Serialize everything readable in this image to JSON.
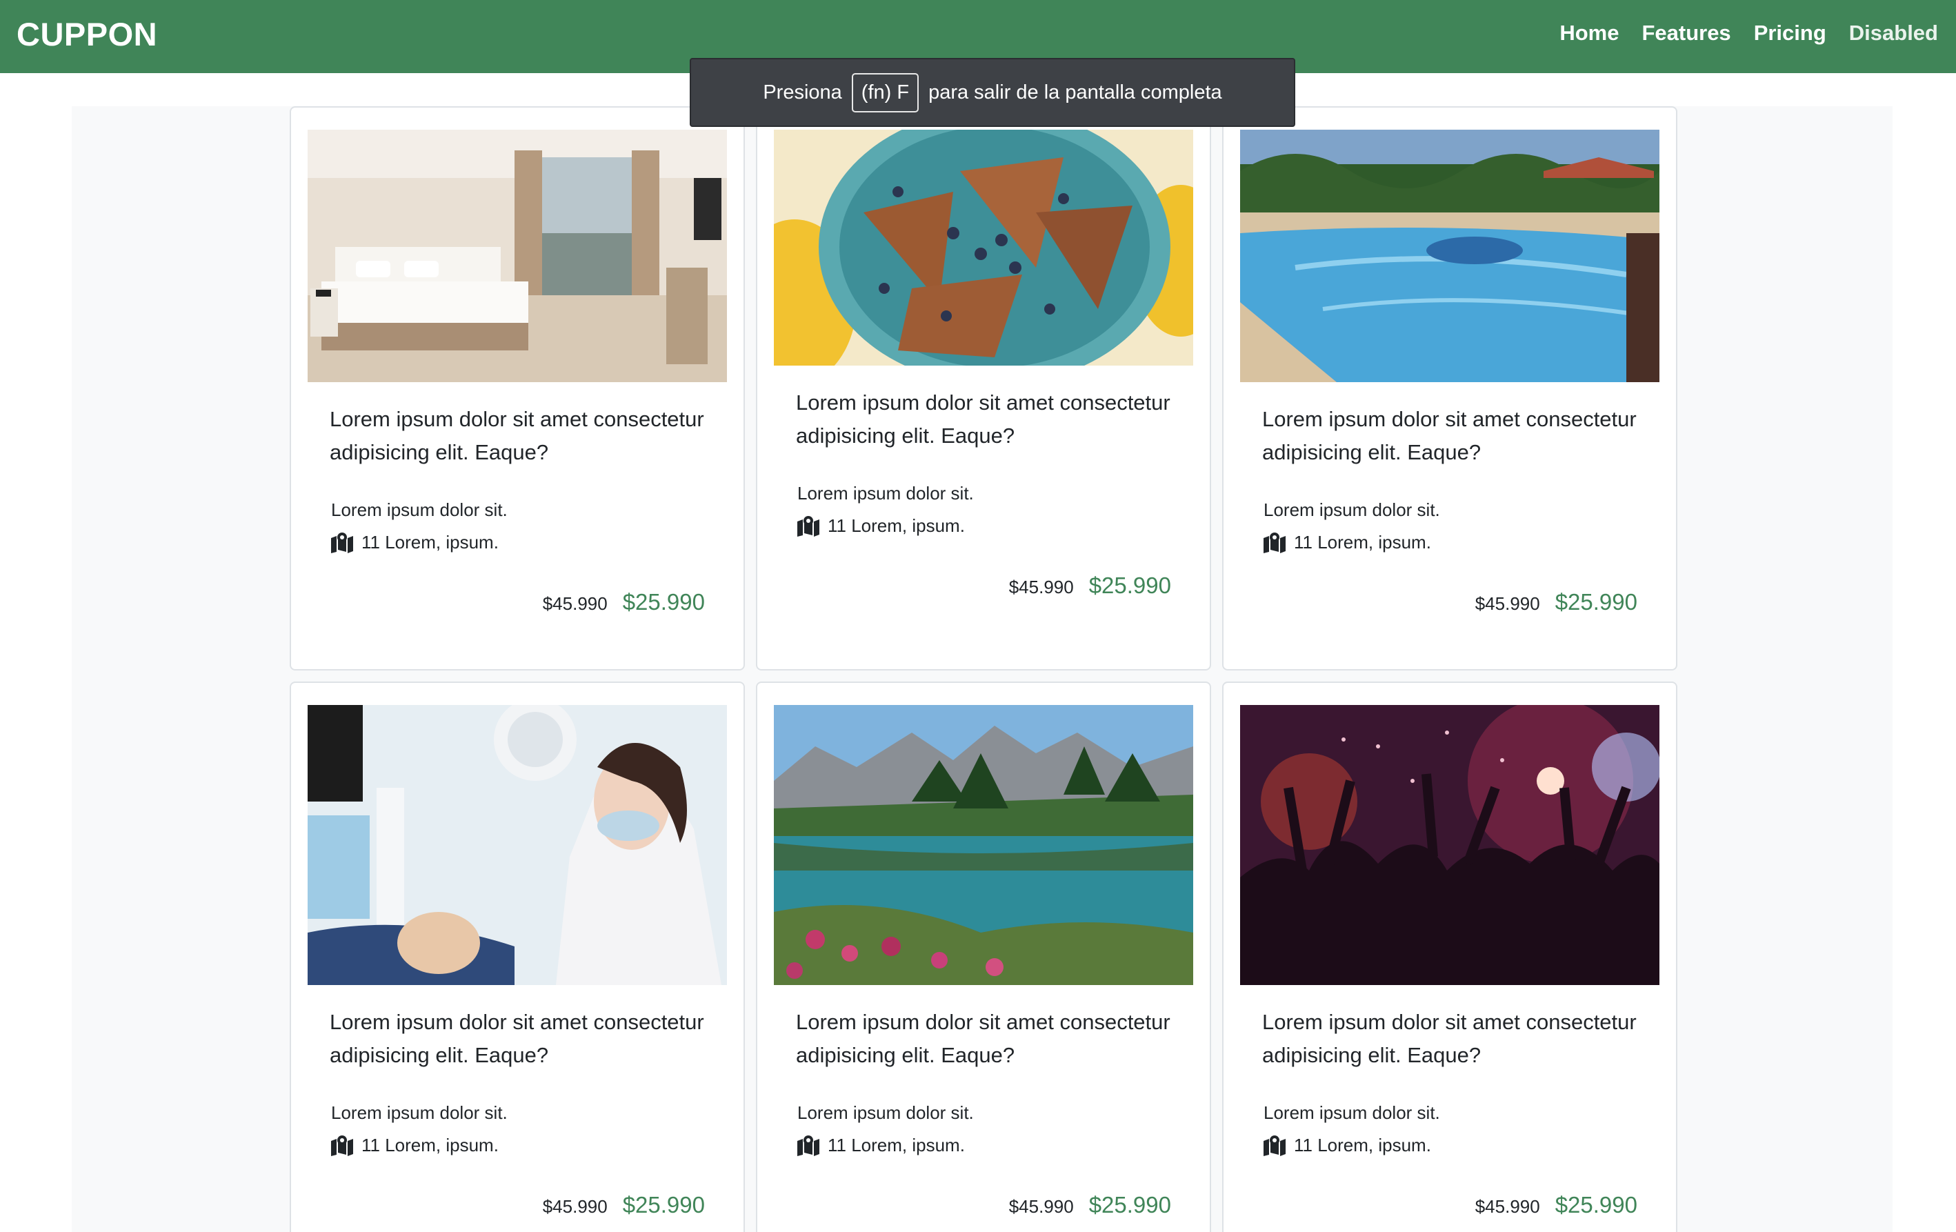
{
  "navbar": {
    "brand": "CUPPON",
    "links": [
      {
        "label": "Home"
      },
      {
        "label": "Features"
      },
      {
        "label": "Pricing"
      },
      {
        "label": "Disabled"
      }
    ]
  },
  "fullscreen_notice": {
    "before": "Presiona",
    "key": "(fn) F",
    "after": "para salir de la pantalla completa"
  },
  "cards": [
    {
      "image": "hotel-room",
      "title": "Lorem ipsum dolor sit amet consectetur adipisicing elit. Eaque?",
      "subtitle": "Lorem ipsum dolor sit.",
      "location": "11 Lorem, ipsum.",
      "location_icon": "map-marker-icon",
      "old_price": "$45.990",
      "new_price": "$25.990"
    },
    {
      "image": "crepes-with-blueberries",
      "title": "Lorem ipsum dolor sit amet consectetur adipisicing elit. Eaque?",
      "subtitle": "Lorem ipsum dolor sit.",
      "location": "11 Lorem, ipsum.",
      "location_icon": "map-marker-icon",
      "old_price": "$45.990",
      "new_price": "$25.990"
    },
    {
      "image": "swimming-pool",
      "title": "Lorem ipsum dolor sit amet consectetur adipisicing elit. Eaque?",
      "subtitle": "Lorem ipsum dolor sit.",
      "location": "11 Lorem, ipsum.",
      "location_icon": "map-marker-icon",
      "old_price": "$45.990",
      "new_price": "$25.990"
    },
    {
      "image": "dentist",
      "title": "Lorem ipsum dolor sit amet consectetur adipisicing elit. Eaque?",
      "subtitle": "Lorem ipsum dolor sit.",
      "location": "11 Lorem, ipsum.",
      "location_icon": "map-marker-icon",
      "old_price": "$45.990",
      "new_price": "$25.990"
    },
    {
      "image": "mountain-lake",
      "title": "Lorem ipsum dolor sit amet consectetur adipisicing elit. Eaque?",
      "subtitle": "Lorem ipsum dolor sit.",
      "location": "11 Lorem, ipsum.",
      "location_icon": "map-marker-icon",
      "old_price": "$45.990",
      "new_price": "$25.990"
    },
    {
      "image": "party-crowd",
      "title": "Lorem ipsum dolor sit amet consectetur adipisicing elit. Eaque?",
      "subtitle": "Lorem ipsum dolor sit.",
      "location": "11 Lorem, ipsum.",
      "location_icon": "map-marker-icon",
      "old_price": "$45.990",
      "new_price": "$25.990"
    }
  ],
  "colors": {
    "brand_green": "#408558",
    "price_green": "#408558",
    "toast_bg": "#3e4146"
  }
}
